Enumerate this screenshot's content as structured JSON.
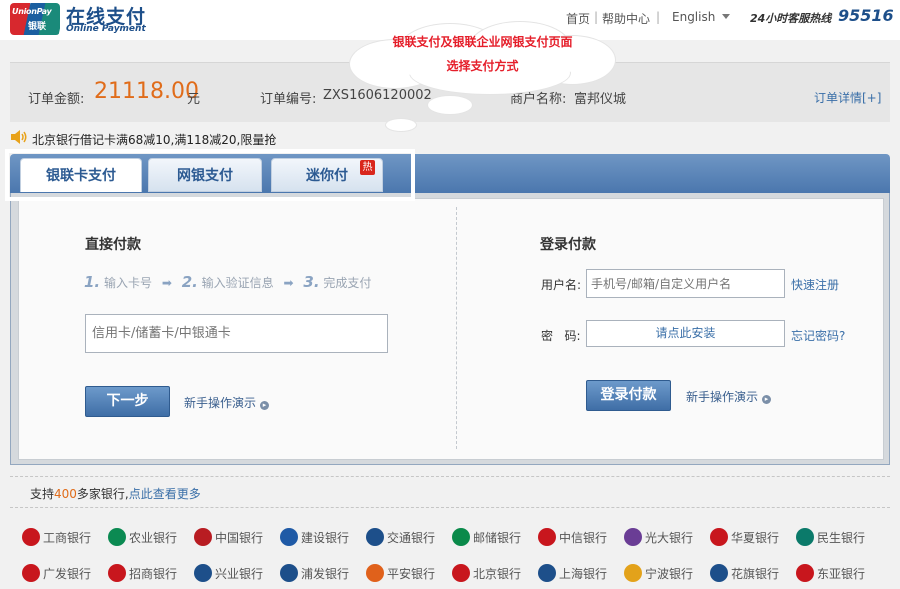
{
  "header": {
    "logo_text_top": "UnionPay",
    "logo_text_bottom": "银联",
    "title": "在线支付",
    "subtitle": "Online Payment",
    "nav_home": "首页",
    "nav_help": "帮助中心",
    "language": "English",
    "hotline_label": "24小时客服热线",
    "hotline_number": "95516"
  },
  "annotation": {
    "line1": "银联支付及银联企业网银支付页面",
    "line2": "选择支付方式"
  },
  "order": {
    "amount_label": "订单金额:",
    "amount_value": "21118.00",
    "amount_unit": "元",
    "order_no_label": "订单编号:",
    "order_no_value": "ZXS1606120002",
    "merchant_label": "商户名称:",
    "merchant_value": "富邦仪城",
    "detail_link": "订单详情[+]"
  },
  "promo": {
    "text": "北京银行借记卡满68减10,满118减20,限量抢"
  },
  "tabs": [
    {
      "label": "银联卡支付"
    },
    {
      "label": "网银支付"
    },
    {
      "label": "迷你付",
      "badge": "热"
    }
  ],
  "direct_pay": {
    "title": "直接付款",
    "steps": [
      {
        "num": "1.",
        "label": "输入卡号"
      },
      {
        "num": "2.",
        "label": "输入验证信息"
      },
      {
        "num": "3.",
        "label": "完成支付"
      }
    ],
    "card_placeholder": "信用卡/储蓄卡/中银通卡",
    "next_button": "下一步",
    "demo_link": "新手操作演示"
  },
  "login_pay": {
    "title": "登录付款",
    "username_label": "用户名:",
    "username_placeholder": "手机号/邮箱/自定义用户名",
    "register_link": "快速注册",
    "password_label": "密   码:",
    "install_link": "请点此安装",
    "forgot_link": "忘记密码?",
    "login_button": "登录付款",
    "demo_link": "新手操作演示"
  },
  "banks": {
    "support_prefix": "支持",
    "support_count": "400",
    "support_suffix": "多家银行,",
    "view_more": "点此查看更多",
    "row1": [
      "工商银行",
      "农业银行",
      "中国银行",
      "建设银行",
      "交通银行",
      "邮储银行",
      "中信银行",
      "光大银行",
      "华夏银行",
      "民生银行"
    ],
    "row2": [
      "广发银行",
      "招商银行",
      "兴业银行",
      "浦发银行",
      "平安银行",
      "北京银行",
      "上海银行",
      "宁波银行",
      "花旗银行",
      "东亚银行"
    ],
    "row1_colors": [
      "#c8161d",
      "#0b8a52",
      "#b81c22",
      "#1f5aa6",
      "#1d4f8a",
      "#0a8a4a",
      "#c8161d",
      "#6a3d95",
      "#c8161d",
      "#0b7a6a"
    ],
    "row2_colors": [
      "#c8161d",
      "#c8161d",
      "#1d4f8a",
      "#1d4f8a",
      "#e0611b",
      "#c8161d",
      "#1d4f8a",
      "#e3a21a",
      "#1d4f8a",
      "#c8161d"
    ]
  }
}
